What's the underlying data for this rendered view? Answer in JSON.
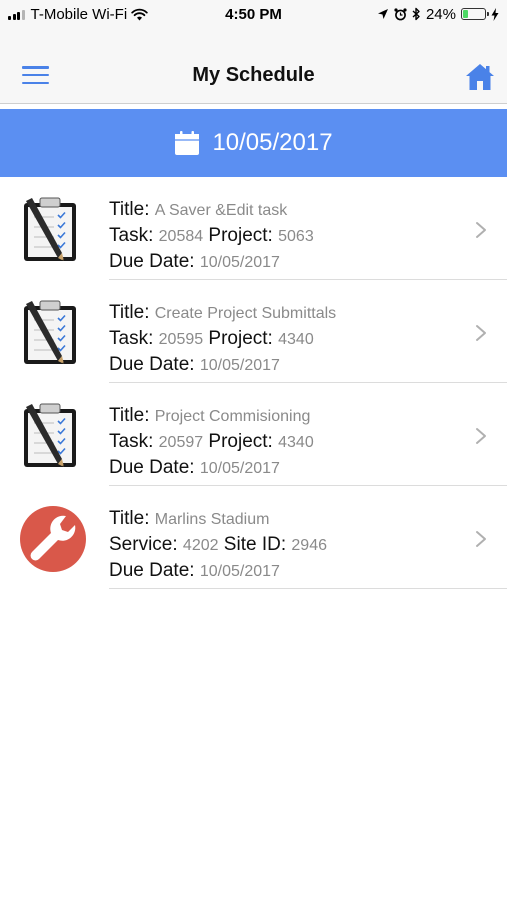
{
  "status_bar": {
    "carrier": "T-Mobile Wi-Fi",
    "time": "4:50 PM",
    "battery": "24%",
    "battery_level": 0.24
  },
  "nav": {
    "title": "My Schedule",
    "menu_icon": "hamburger-menu-icon",
    "home_icon": "home-icon"
  },
  "date_bar": {
    "date": "10/05/2017",
    "icon": "calendar-icon"
  },
  "colors": {
    "accent": "#4a82e8",
    "date_bar": "#5b8ff2",
    "service_icon": "#d9584a"
  },
  "items": [
    {
      "type": "task",
      "icon": "clipboard-checklist-icon",
      "title_label": "Title:",
      "title": "A Saver &Edit task",
      "k1_label": "Task:",
      "k1": "20584",
      "k2_label": "Project:",
      "k2": "5063",
      "due_label": "Due Date:",
      "due": "10/05/2017"
    },
    {
      "type": "task",
      "icon": "clipboard-checklist-icon",
      "title_label": "Title:",
      "title": "Create Project Submittals",
      "k1_label": "Task:",
      "k1": "20595",
      "k2_label": "Project:",
      "k2": "4340",
      "due_label": "Due Date:",
      "due": "10/05/2017"
    },
    {
      "type": "task",
      "icon": "clipboard-checklist-icon",
      "title_label": "Title:",
      "title": "Project Commisioning",
      "k1_label": "Task:",
      "k1": "20597",
      "k2_label": "Project:",
      "k2": "4340",
      "due_label": "Due Date:",
      "due": "10/05/2017"
    },
    {
      "type": "service",
      "icon": "wrench-icon",
      "title_label": "Title:",
      "title": "Marlins Stadium",
      "k1_label": "Service:",
      "k1": "4202",
      "k2_label": "Site ID:",
      "k2": "2946",
      "due_label": "Due Date:",
      "due": "10/05/2017"
    }
  ]
}
